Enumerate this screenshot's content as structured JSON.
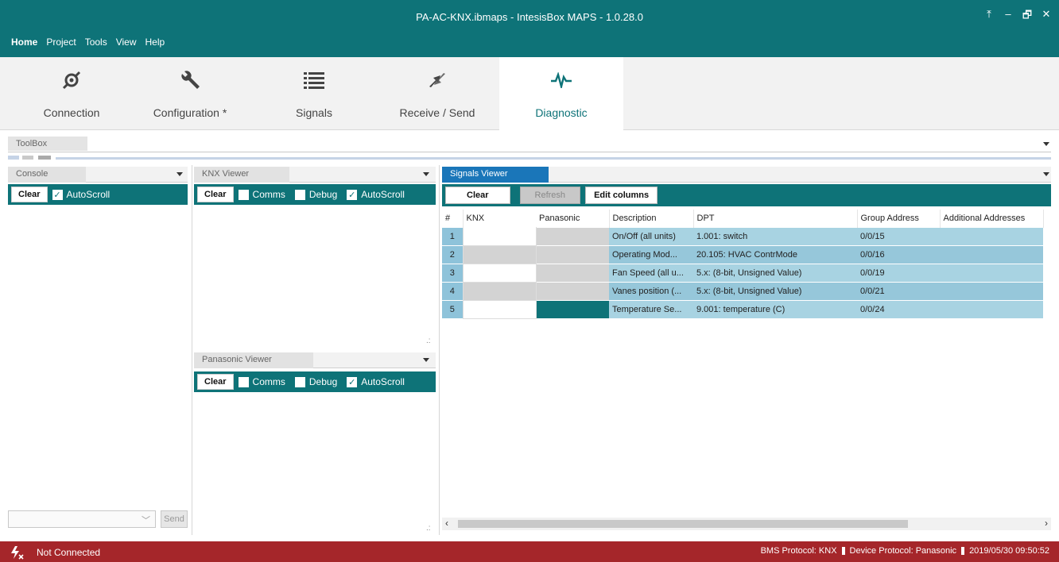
{
  "window": {
    "title": "PA-AC-KNX.ibmaps - IntesisBox MAPS - 1.0.28.0",
    "controls": [
      "⤒",
      "–",
      "🗗",
      "✕"
    ]
  },
  "menu": [
    "Home",
    "Project",
    "Tools",
    "View",
    "Help"
  ],
  "ribbon": {
    "tabs": [
      {
        "label": "Connection",
        "icon": "connection-icon"
      },
      {
        "label": "Configuration *",
        "icon": "wrench-icon"
      },
      {
        "label": "Signals",
        "icon": "list-icon"
      },
      {
        "label": "Receive / Send",
        "icon": "arrows-icon"
      },
      {
        "label": "Diagnostic",
        "icon": "pulse-icon"
      }
    ],
    "active": "Diagnostic"
  },
  "toolbox": {
    "label": "ToolBox"
  },
  "console": {
    "title": "Console",
    "clear": "Clear",
    "autoscroll": "AutoScroll",
    "send": "Send"
  },
  "knx_viewer": {
    "title": "KNX Viewer",
    "clear": "Clear",
    "comms": "Comms",
    "debug": "Debug",
    "autoscroll": "AutoScroll"
  },
  "panasonic_viewer": {
    "title": "Panasonic Viewer",
    "clear": "Clear",
    "comms": "Comms",
    "debug": "Debug",
    "autoscroll": "AutoScroll"
  },
  "signals_viewer": {
    "title": "Signals Viewer",
    "clear": "Clear",
    "refresh": "Refresh",
    "edit_columns": "Edit columns",
    "columns": [
      "#",
      "KNX",
      "Panasonic",
      "Description",
      "DPT",
      "Group Address",
      "Additional Addresses"
    ],
    "rows": [
      {
        "num": "1",
        "description": "On/Off (all units)",
        "dpt": "1.001: switch",
        "group": "0/0/15"
      },
      {
        "num": "2",
        "description": "Operating Mod...",
        "dpt": "20.105: HVAC ContrMode",
        "group": "0/0/16"
      },
      {
        "num": "3",
        "description": "Fan Speed (all u...",
        "dpt": "5.x: (8-bit, Unsigned Value)",
        "group": "0/0/19"
      },
      {
        "num": "4",
        "description": "Vanes position (...",
        "dpt": "5.x: (8-bit, Unsigned Value)",
        "group": "0/0/21"
      },
      {
        "num": "5",
        "description": "Temperature Se...",
        "dpt": "9.001: temperature (C)",
        "group": "0/0/24"
      }
    ]
  },
  "status": {
    "connection": "Not Connected",
    "bms": "BMS Protocol: KNX",
    "device": "Device Protocol: Panasonic",
    "datetime": "2019/05/30 09:50:52"
  },
  "colors": {
    "teal": "#0e7378",
    "blue_tab": "#1a76b9",
    "status_red": "#a5262a"
  }
}
